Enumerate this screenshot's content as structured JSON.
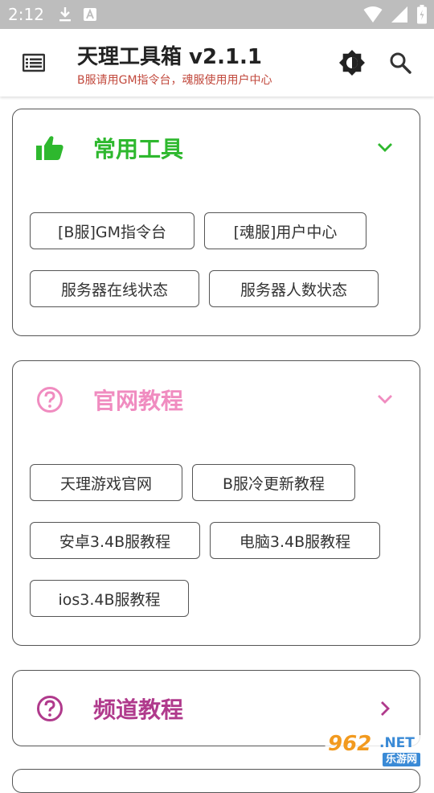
{
  "status_bar": {
    "time": "2:12"
  },
  "header": {
    "title": "天理工具箱 v2.1.1",
    "subtitle": "B服请用GM指令台，魂服使用用户中心"
  },
  "colors": {
    "green": "#2eb82e",
    "pink": "#f08cc0",
    "magenta": "#b03a8c",
    "subtitle_red": "#c24a3e"
  },
  "sections": [
    {
      "title": "常用工具",
      "icon": "thumbs-up-icon",
      "state": "expanded",
      "buttons": [
        "[B服]GM指令台",
        "[魂服]用户中心",
        "服务器在线状态",
        "服务器人数状态"
      ]
    },
    {
      "title": "官网教程",
      "icon": "help-circle-icon",
      "state": "expanded",
      "buttons": [
        "天理游戏官网",
        "B服冷更新教程",
        "安卓3.4B服教程",
        "电脑3.4B服教程",
        "ios3.4B服教程"
      ]
    },
    {
      "title": "频道教程",
      "icon": "help-circle-icon",
      "state": "collapsed",
      "buttons": []
    }
  ],
  "watermark": {
    "number": "962",
    "suffix": ".NET",
    "caption": "乐游网"
  }
}
